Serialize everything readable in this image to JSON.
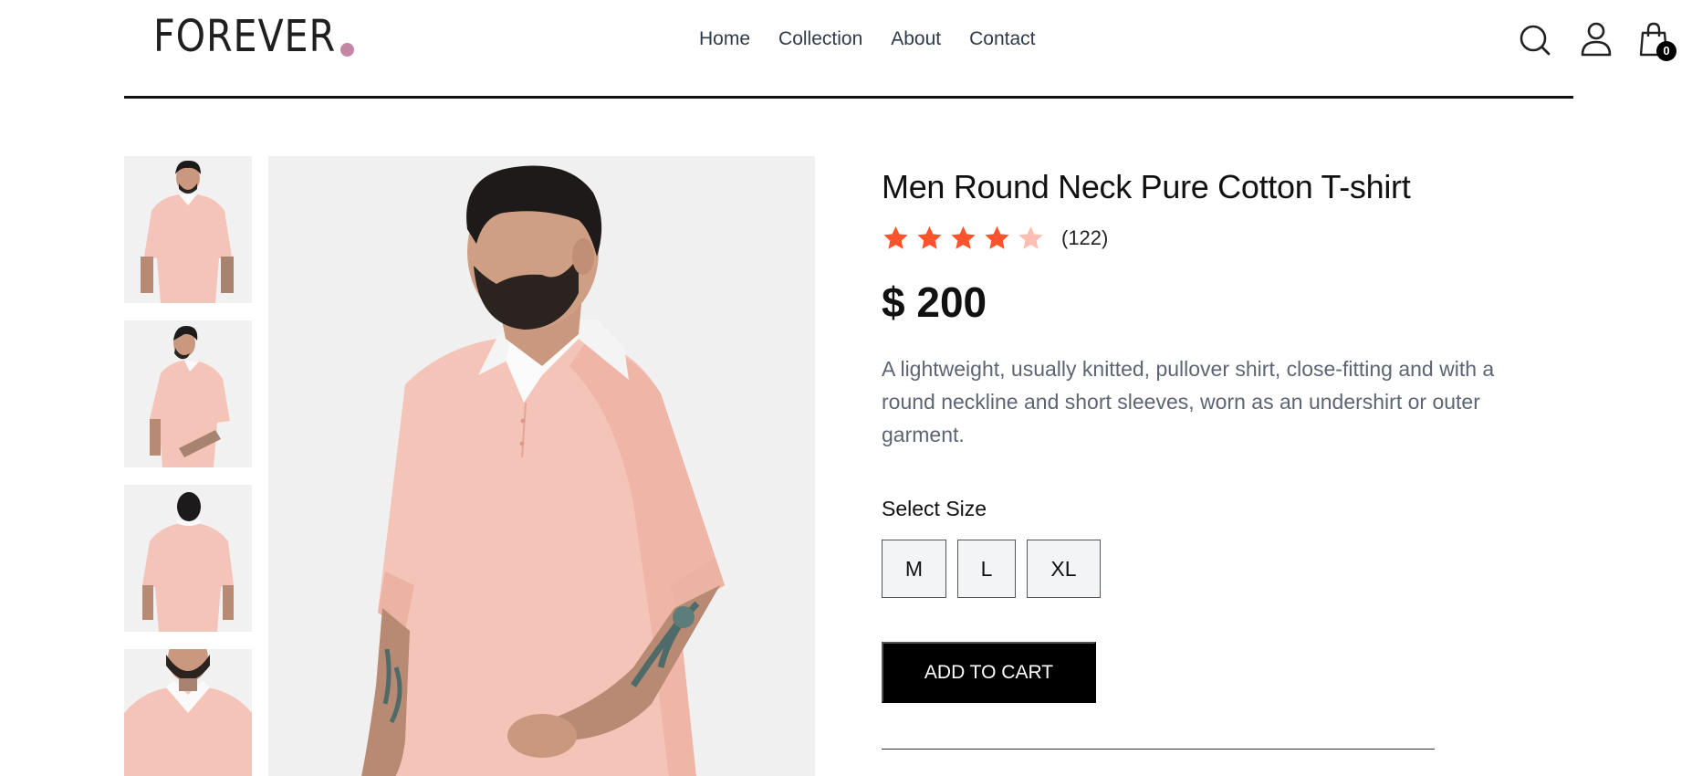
{
  "header": {
    "logo_text": "FOREVER",
    "logo_dot_color": "#c586a5",
    "nav": [
      {
        "label": "Home"
      },
      {
        "label": "Collection"
      },
      {
        "label": "About"
      },
      {
        "label": "Contact"
      }
    ],
    "icons": [
      "search-icon",
      "profile-icon",
      "cart-icon"
    ],
    "cart_count": "0"
  },
  "gallery": {
    "thumbnails": [
      {
        "view": "front"
      },
      {
        "view": "side"
      },
      {
        "view": "back"
      },
      {
        "view": "closeup"
      }
    ],
    "product_color": "#f5c4b8"
  },
  "product": {
    "title": "Men Round Neck Pure Cotton T-shirt",
    "rating": 4,
    "rating_max": 5,
    "star_color": "#ff532e",
    "star_empty_color": "#ffc0b3",
    "review_count": "(122)",
    "price": "$ 200",
    "description": "A lightweight, usually knitted, pullover shirt, close-fitting and with a round neckline and short sleeves, worn as an undershirt or outer garment.",
    "size_label": "Select Size",
    "sizes": [
      "M",
      "L",
      "XL"
    ],
    "add_to_cart_label": "ADD TO CART"
  }
}
